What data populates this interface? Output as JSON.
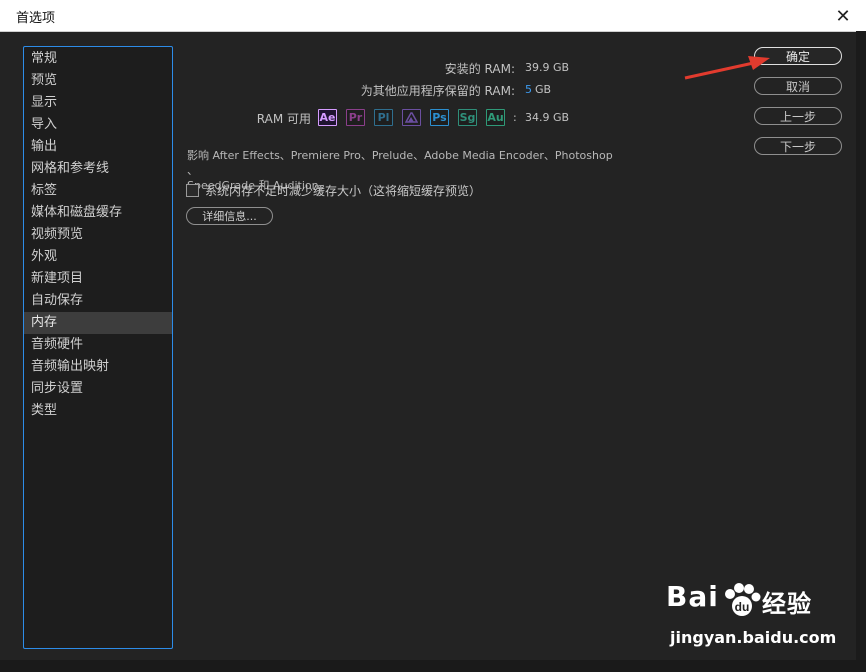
{
  "window": {
    "title": "首选项",
    "close_glyph": "✕"
  },
  "sidebar": {
    "items": [
      {
        "label": "常规"
      },
      {
        "label": "预览"
      },
      {
        "label": "显示"
      },
      {
        "label": "导入"
      },
      {
        "label": "输出"
      },
      {
        "label": "网格和参考线"
      },
      {
        "label": "标签"
      },
      {
        "label": "媒体和磁盘缓存"
      },
      {
        "label": "视频预览"
      },
      {
        "label": "外观"
      },
      {
        "label": "新建项目"
      },
      {
        "label": "自动保存"
      },
      {
        "label": "内存",
        "active": true
      },
      {
        "label": "音频硬件"
      },
      {
        "label": "音频输出映射"
      },
      {
        "label": "同步设置"
      },
      {
        "label": "类型"
      }
    ]
  },
  "memory": {
    "installed_label": "安装的 RAM:",
    "installed_value": "39.9 GB",
    "reserved_label": "为其他应用程序保留的 RAM:",
    "reserved_number": "5",
    "reserved_unit": "GB",
    "available_label": "RAM 可用",
    "available_sep": ":",
    "available_value": "34.9 GB",
    "apps": [
      {
        "abbr": "Ae",
        "name": "after-effects",
        "color": "#d59cff",
        "active": true
      },
      {
        "abbr": "Pr",
        "name": "premiere-pro",
        "color": "#8b3f8b"
      },
      {
        "abbr": "Pl",
        "name": "prelude",
        "color": "#2f6f8f"
      },
      {
        "abbr": "AME",
        "name": "media-encoder",
        "color": "#6b4fa0"
      },
      {
        "abbr": "Ps",
        "name": "photoshop",
        "color": "#2c8fd0"
      },
      {
        "abbr": "Sg",
        "name": "speedgrade",
        "color": "#2f8f7a"
      },
      {
        "abbr": "Au",
        "name": "audition",
        "color": "#2f9a78"
      }
    ],
    "description_line1": "影响 After Effects、Premiere Pro、Prelude、Adobe Media Encoder、Photoshop 、",
    "description_line2": "SpeedGrade 和 Audition。",
    "checkbox_label": "系统内存不足时减少缓存大小（这将缩短缓存预览）",
    "details_button": "详细信息..."
  },
  "buttons": {
    "ok": "确定",
    "cancel": "取消",
    "previous": "上一步",
    "next": "下一步"
  },
  "watermark": {
    "brand_left": "Bai",
    "brand_right": "经验",
    "url": "jingyan.baidu.com"
  },
  "colors": {
    "accent_blue": "#3d9bf0",
    "arrow_red": "#e23b2e"
  }
}
